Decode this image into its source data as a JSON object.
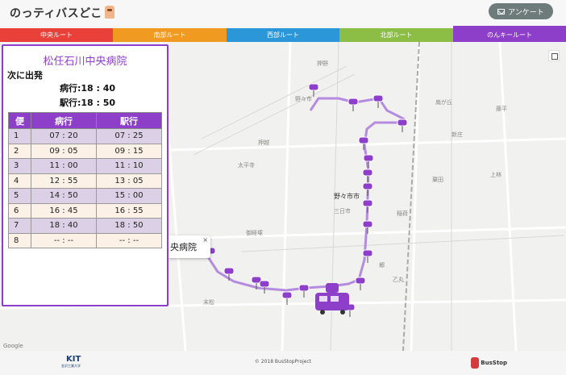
{
  "header": {
    "app_title": "のっティバスどこ",
    "survey_label": "アンケート"
  },
  "tabs": [
    {
      "label": "中央ルート",
      "color": "#e94139",
      "active": false
    },
    {
      "label": "南部ルート",
      "color": "#f19a22",
      "active": false
    },
    {
      "label": "西部ルート",
      "color": "#2b97d8",
      "active": false
    },
    {
      "label": "北部ルート",
      "color": "#8cbd45",
      "active": false
    },
    {
      "label": "のんキールート",
      "color": "#8e3fc9",
      "active": true
    }
  ],
  "info": {
    "stop_name": "松任石川中央病院",
    "next_label": "次に出発",
    "hospital_next": "病行:18 : 40",
    "station_next": "駅行:18 : 50",
    "headers": [
      "便",
      "病行",
      "駅行"
    ],
    "rows": [
      [
        "1",
        "07 : 20",
        "07 : 25"
      ],
      [
        "2",
        "09 : 05",
        "09 : 15"
      ],
      [
        "3",
        "11 : 00",
        "11 : 10"
      ],
      [
        "4",
        "12 : 55",
        "13 : 05"
      ],
      [
        "5",
        "14 : 50",
        "15 : 00"
      ],
      [
        "6",
        "16 : 45",
        "16 : 55"
      ],
      [
        "7",
        "18 : 40",
        "18 : 50"
      ],
      [
        "8",
        "-- : --",
        "-- : --"
      ]
    ]
  },
  "map": {
    "city_label": "野々市市",
    "popup_text": "央病院",
    "popup_close": "×",
    "labels": [
      "野々市",
      "押野",
      "太平寺",
      "御経塚",
      "粟田",
      "稲荷",
      "新庄",
      "扇が丘",
      "末松",
      "郷",
      "上林",
      "押越",
      "三日市",
      "藤平",
      "乙丸"
    ],
    "route_color": "#b58be0"
  },
  "footer": {
    "kit_mark": "KIT",
    "kit_sub": "金沢工業大学",
    "copyright": "© 2018 BusStopProject",
    "bs_logo": "BusStop"
  },
  "google_brand": "Google"
}
